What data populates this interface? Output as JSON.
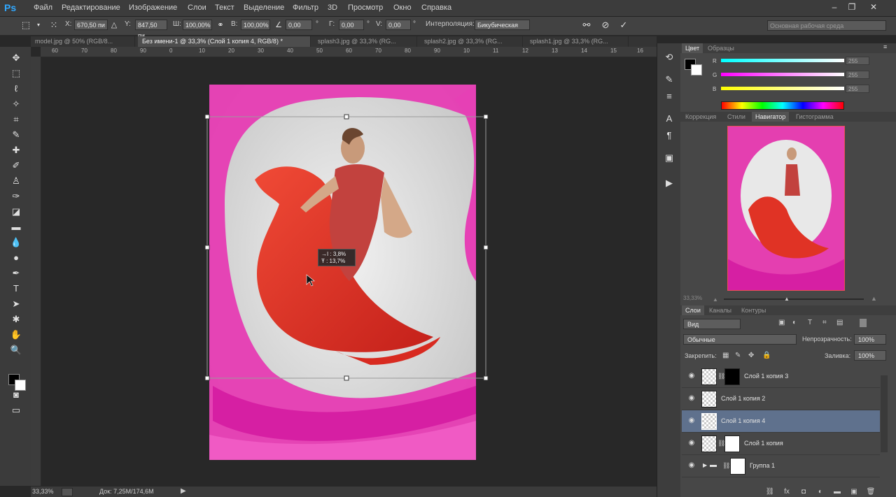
{
  "app": {
    "logo": "Ps"
  },
  "menu": [
    "Файл",
    "Редактирование",
    "Изображение",
    "Слои",
    "Текст",
    "Выделение",
    "Фильтр",
    "3D",
    "Просмотр",
    "Окно",
    "Справка"
  ],
  "options": {
    "x_label": "X:",
    "x_value": "670,50 пи",
    "y_label": "Y:",
    "y_value": "847,50 пи",
    "w_label": "Ш:",
    "w_value": "100,00%",
    "h_label": "В:",
    "h_value": "100,00%",
    "angle_value": "0,00",
    "angle_unit": "°",
    "hskew_label": "Г:",
    "hskew_value": "0,00",
    "hskew_unit": "°",
    "vskew_label": "V:",
    "vskew_value": "0,00",
    "vskew_unit": "°",
    "interp_label": "Интерполяция:",
    "interp_value": "Бикубическая",
    "workspace": "Основная рабочая среда"
  },
  "tabs": [
    {
      "label": "model.jpg @ 50% (RGB/8..."
    },
    {
      "label": "Без имени-1 @ 33,3% (Слой 1 копия 4, RGB/8) *"
    },
    {
      "label": "splash3.jpg @ 33,3% (RG..."
    },
    {
      "label": "splash2.jpg @ 33,3% (RG..."
    },
    {
      "label": "splash1.jpg @ 33,3% (RG..."
    }
  ],
  "ruler": [
    "60",
    "70",
    "80",
    "90",
    "0",
    "10",
    "20",
    "30",
    "40",
    "50",
    "60",
    "70",
    "80",
    "90",
    "10",
    "11",
    "12",
    "13",
    "14",
    "15",
    "16"
  ],
  "transform_tip": {
    "line1": "→I : 3,8%",
    "line2": "Ŧ : 13,7%"
  },
  "status": {
    "zoom": "33,33%",
    "doc": "Док: 7,25M/174,6M"
  },
  "color_panel": {
    "tabs": [
      "Цвет",
      "Образцы"
    ],
    "r_label": "R",
    "g_label": "G",
    "b_label": "B",
    "r": "255",
    "g": "255",
    "b": "255"
  },
  "nav_panel": {
    "tabs": [
      "Коррекция",
      "Стили",
      "Навигатор",
      "Гистограмма"
    ],
    "zoom": "33,33%"
  },
  "layers_panel": {
    "tabs": [
      "Слои",
      "Каналы",
      "Контуры"
    ],
    "filter": "Вид",
    "blend_mode": "Обычные",
    "opacity_label": "Непрозрачность:",
    "opacity": "100%",
    "lock_label": "Закрепить:",
    "fill_label": "Заливка:",
    "fill": "100%",
    "layers": [
      {
        "name": "Слой 1 копия 3"
      },
      {
        "name": "Слой 1 копия 2"
      },
      {
        "name": "Слой 1 копия 4"
      },
      {
        "name": "Слой 1 копия"
      },
      {
        "name": "Группа 1"
      }
    ]
  },
  "colors": {
    "accent": "#31a8ff",
    "selected_layer": "#5f718d",
    "magenta": "#e43fb0",
    "red": "#e03325"
  }
}
